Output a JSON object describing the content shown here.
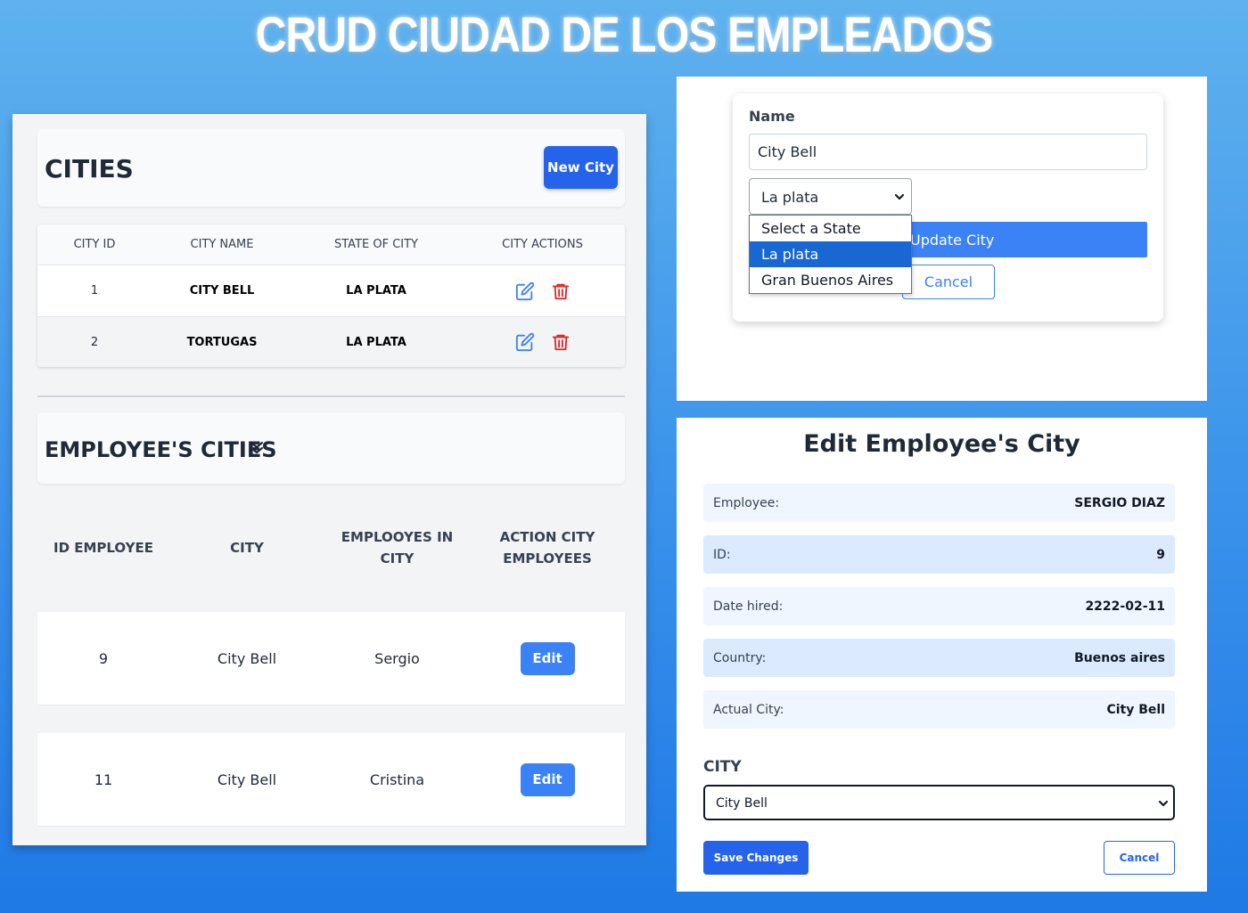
{
  "page": {
    "title": "CRUD CIUDAD DE LOS EMPLEADOS"
  },
  "cities": {
    "title": "CITIES",
    "new_button": "New City",
    "headers": [
      "CITY ID",
      "CITY NAME",
      "STATE OF CITY",
      "CITY ACTIONS"
    ],
    "rows": [
      {
        "id": "1",
        "name": "CITY BELL",
        "state": "LA PLATA"
      },
      {
        "id": "2",
        "name": "TORTUGAS",
        "state": "LA PLATA"
      }
    ],
    "icons": {
      "edit": "edit-icon",
      "delete": "trash-icon"
    },
    "colors": {
      "edit": "#3b82f6",
      "delete": "#dc2626"
    }
  },
  "employees": {
    "title": "EMPLOYEE'S CITIES",
    "chevron_icon": "double-chevron-down-icon",
    "headers": [
      "ID EMPLOYEE",
      "CITY",
      "EMPLOOYES IN CITY",
      "ACTION CITY EMPLOYEES"
    ],
    "rows": [
      {
        "id": "9",
        "city": "City Bell",
        "employee": "Sergio",
        "action": "Edit"
      },
      {
        "id": "11",
        "city": "City Bell",
        "employee": "Cristina",
        "action": "Edit"
      }
    ]
  },
  "city_form": {
    "name_label": "Name",
    "name_value": "City Bell",
    "state_selected": "La plata",
    "state_options": [
      "Select a State",
      "La plata",
      "Gran Buenos Aires"
    ],
    "update_button": "Update City",
    "cancel_button": "Cancel"
  },
  "edit_employee": {
    "title": "Edit Employee's City",
    "fields": [
      {
        "label": "Employee:",
        "value": "SERGIO DIAZ"
      },
      {
        "label": "ID:",
        "value": "9"
      },
      {
        "label": "Date hired:",
        "value": "2222-02-11"
      },
      {
        "label": "Country:",
        "value": "Buenos aires"
      },
      {
        "label": "Actual City:",
        "value": "City Bell"
      }
    ],
    "city_label": "CITY",
    "city_selected": "City Bell",
    "save_button": "Save Changes",
    "cancel_button": "Cancel"
  },
  "colors": {
    "primary": "#2563eb",
    "accent": "#3b82f6",
    "danger": "#dc2626",
    "selected_option": "#1967d2"
  }
}
